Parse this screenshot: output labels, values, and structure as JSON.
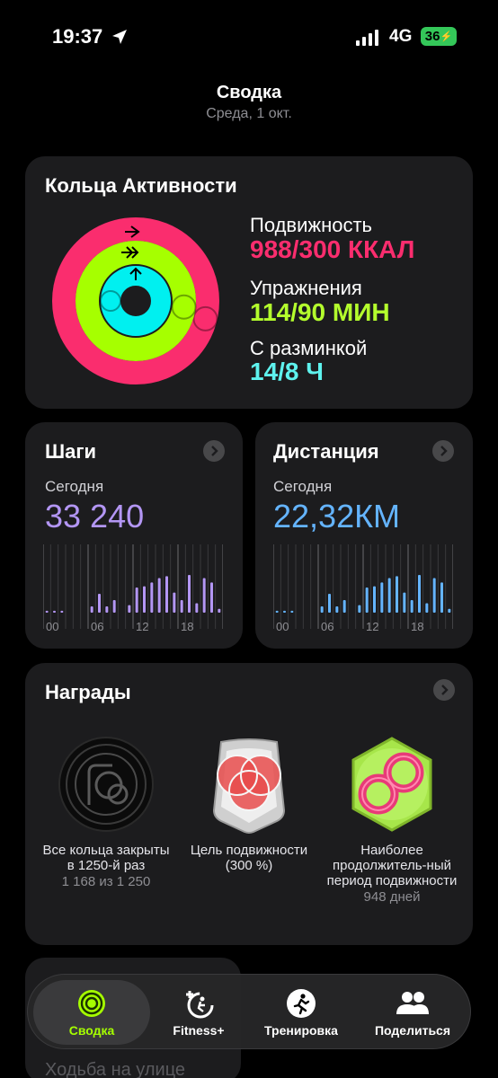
{
  "status": {
    "time": "19:37",
    "network": "4G",
    "battery": "36"
  },
  "header": {
    "title": "Сводка",
    "date": "Среда, 1 окт."
  },
  "activity": {
    "title": "Кольца Активности",
    "move": {
      "label": "Подвижность",
      "value": "988/300 ККАЛ",
      "color": "#fa2d6e",
      "fraction": 3.29
    },
    "exercise": {
      "label": "Упражнения",
      "value": "114/90 МИН",
      "color": "#a6ff00",
      "fraction": 1.27
    },
    "stand": {
      "label": "С разминкой",
      "value": "14/8 Ч",
      "color": "#00f0f0",
      "fraction": 1.75
    }
  },
  "steps": {
    "title": "Шаги",
    "subtitle": "Сегодня",
    "value": "33 240",
    "color": "#b396f4",
    "axis": [
      "00",
      "06",
      "12",
      "18"
    ],
    "hourly": [
      0.03,
      0.03,
      0.03,
      0,
      0,
      0,
      0.1,
      0.3,
      0.1,
      0.2,
      0,
      0.12,
      0.4,
      0.42,
      0.48,
      0.55,
      0.58,
      0.32,
      0.2,
      0.6,
      0.15,
      0.55,
      0.48,
      0.06
    ]
  },
  "distance": {
    "title": "Дистанция",
    "subtitle": "Сегодня",
    "value": "22,32КМ",
    "color": "#64b4ff",
    "axis": [
      "00",
      "06",
      "12",
      "18"
    ],
    "hourly": [
      0.03,
      0.03,
      0.03,
      0,
      0,
      0,
      0.1,
      0.3,
      0.1,
      0.2,
      0,
      0.12,
      0.4,
      0.42,
      0.48,
      0.55,
      0.58,
      0.32,
      0.2,
      0.6,
      0.15,
      0.55,
      0.48,
      0.06
    ]
  },
  "awards": {
    "title": "Награды",
    "items": [
      {
        "name": "Все кольца закрыты в 1250-й раз",
        "detail": "1 168 из 1 250"
      },
      {
        "name": "Цель подвижности (300 %)",
        "detail": ""
      },
      {
        "name": "Наиболее продолжитель-ный период подвижности",
        "detail": "948 дней"
      }
    ]
  },
  "walk": {
    "title": "Ходьба на улице"
  },
  "tabs": [
    {
      "label": "Сводка",
      "active": true,
      "color": "#a6ff00"
    },
    {
      "label": "Fitness+"
    },
    {
      "label": "Тренировка"
    },
    {
      "label": "Поделиться"
    }
  ]
}
